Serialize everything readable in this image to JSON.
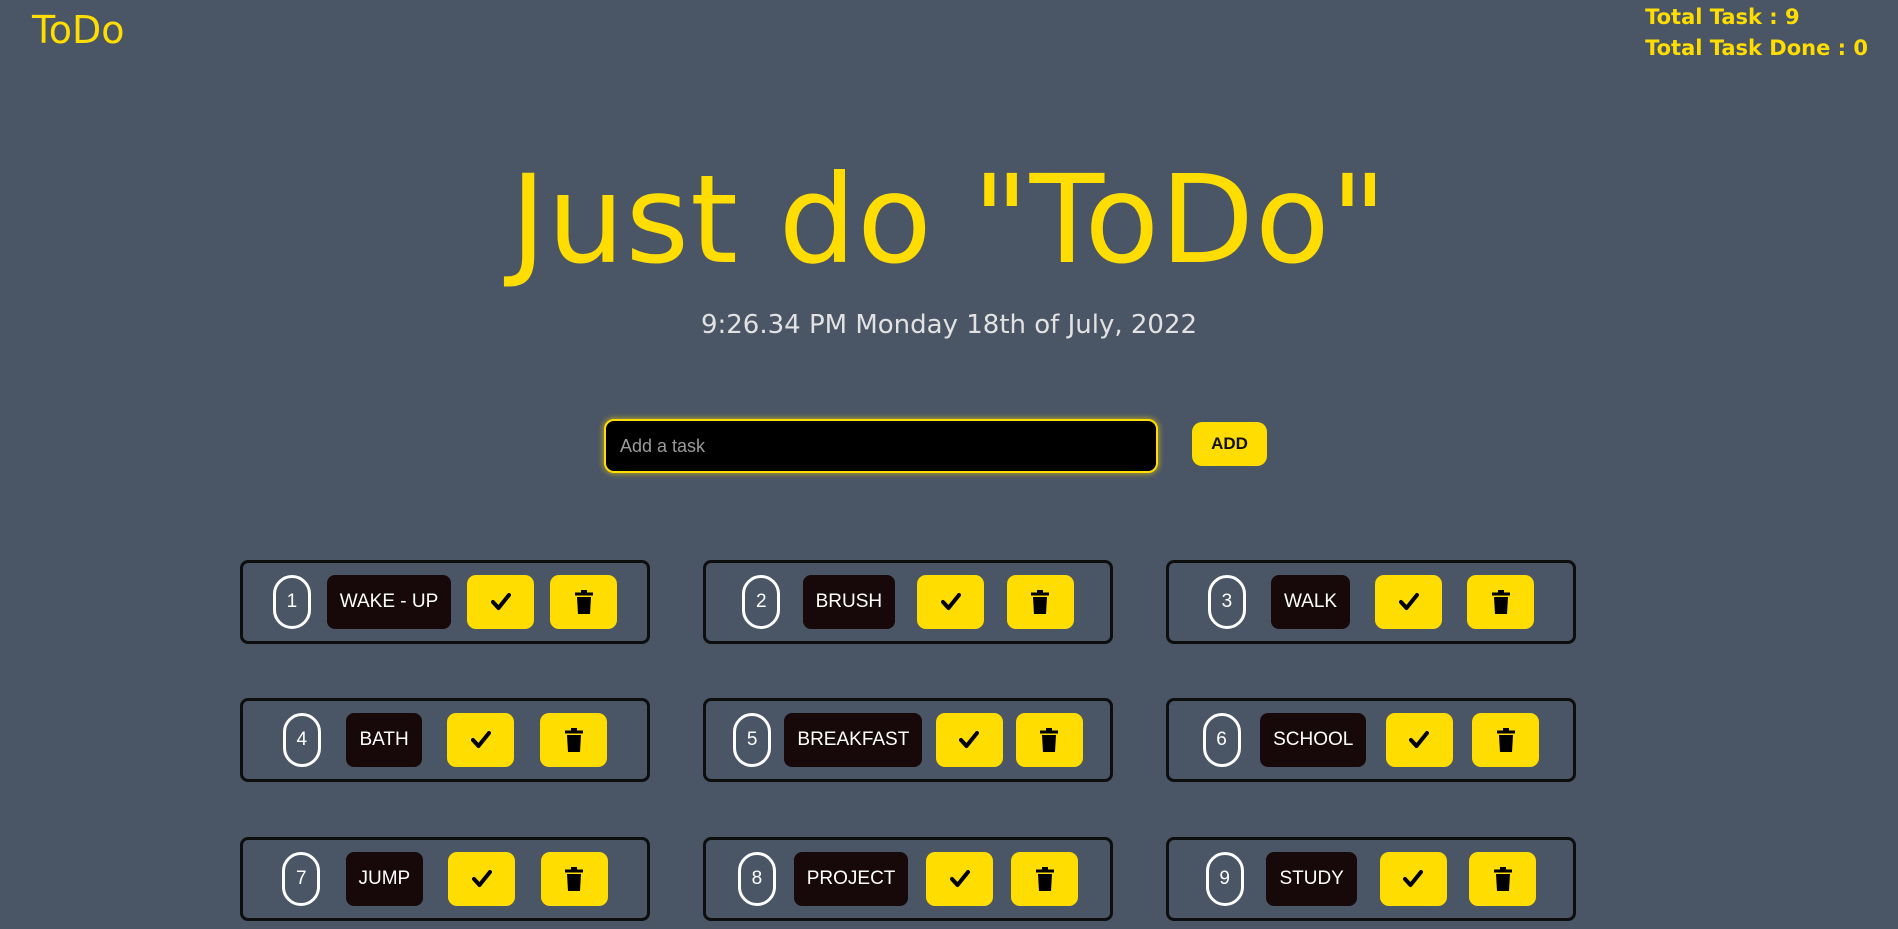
{
  "brand": "ToDo",
  "stats": {
    "total_task_label": "Total Task : 9",
    "total_done_label": "Total Task Done : 0"
  },
  "hero_title": "Just do \"ToDo\"",
  "clock": "9:26.34 PM Monday 18th of July, 2022",
  "input": {
    "placeholder": "Add a task"
  },
  "add_label": "ADD",
  "colors": {
    "background": "#4a5565",
    "accent": "#ffdd00",
    "task_label_bg": "#170909"
  },
  "tasks": [
    {
      "num": "1",
      "label": "WAKE - UP",
      "done": false
    },
    {
      "num": "2",
      "label": "BRUSH",
      "done": false
    },
    {
      "num": "3",
      "label": "WALK",
      "done": false
    },
    {
      "num": "4",
      "label": "BATH",
      "done": false
    },
    {
      "num": "5",
      "label": "BREAKFAST",
      "done": false
    },
    {
      "num": "6",
      "label": "SCHOOL",
      "done": false
    },
    {
      "num": "7",
      "label": "JUMP",
      "done": false
    },
    {
      "num": "8",
      "label": "PROJECT",
      "done": false
    },
    {
      "num": "9",
      "label": "STUDY",
      "done": false
    }
  ],
  "icons": {
    "done": "check-icon",
    "delete": "trash-icon"
  }
}
